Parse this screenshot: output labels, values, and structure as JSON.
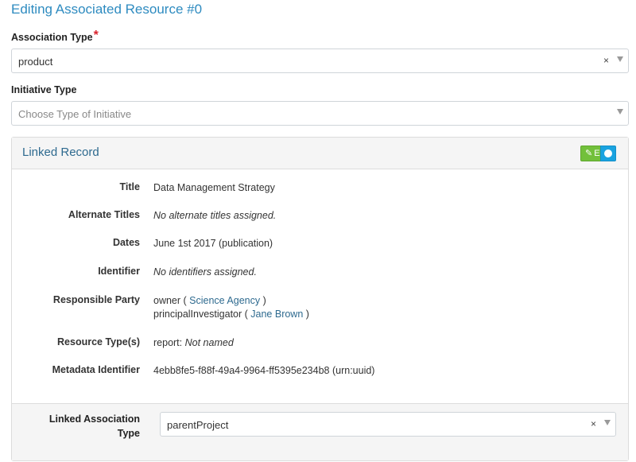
{
  "page": {
    "title": "Editing Associated Resource #0"
  },
  "association_type": {
    "label": "Association Type",
    "required_mark": "*",
    "value": "product",
    "clear": "×"
  },
  "initiative_type": {
    "label": "Initiative Type",
    "placeholder": "Choose Type of Initiative"
  },
  "linked_record": {
    "title": "Linked Record",
    "edit_label": "Edit",
    "details": {
      "title": {
        "label": "Title",
        "value": "Data Management Strategy"
      },
      "alternate_titles": {
        "label": "Alternate Titles",
        "value": "No alternate titles assigned."
      },
      "dates": {
        "label": "Dates",
        "value": "June 1st 2017 (publication)"
      },
      "identifier": {
        "label": "Identifier",
        "value": "No identifiers assigned."
      },
      "responsible_party": {
        "label": "Responsible Party",
        "entries": [
          {
            "role": "owner",
            "open": " ( ",
            "name": "Science Agency",
            "close": " )"
          },
          {
            "role": "principalInvestigator",
            "open": " ( ",
            "name": "Jane Brown",
            "close": " )"
          }
        ]
      },
      "resource_types": {
        "label": "Resource Type(s)",
        "type": "report:",
        "name": "Not named"
      },
      "metadata_identifier": {
        "label": "Metadata Identifier",
        "value": "4ebb8fe5-f88f-49a4-9964-ff5395e234b8 (urn:uuid)"
      }
    },
    "linked_association": {
      "label_line1": "Linked Association",
      "label_line2": "Type",
      "value": "parentProject",
      "clear": "×"
    }
  }
}
